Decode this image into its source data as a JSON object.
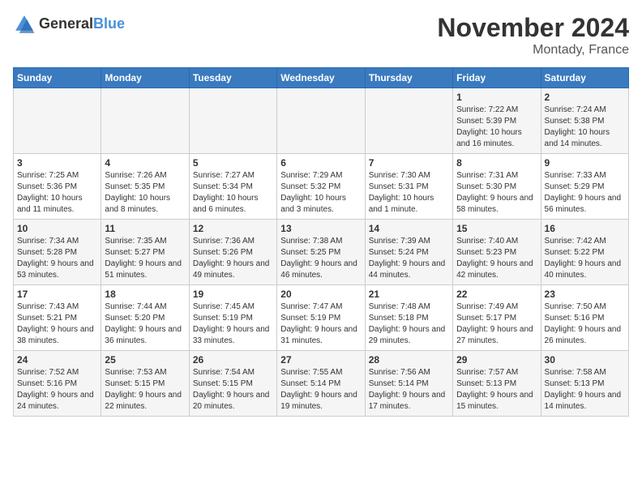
{
  "header": {
    "logo_line1": "General",
    "logo_line2": "Blue",
    "month_title": "November 2024",
    "location": "Montady, France"
  },
  "weekdays": [
    "Sunday",
    "Monday",
    "Tuesday",
    "Wednesday",
    "Thursday",
    "Friday",
    "Saturday"
  ],
  "weeks": [
    [
      {
        "day": "",
        "info": ""
      },
      {
        "day": "",
        "info": ""
      },
      {
        "day": "",
        "info": ""
      },
      {
        "day": "",
        "info": ""
      },
      {
        "day": "",
        "info": ""
      },
      {
        "day": "1",
        "info": "Sunrise: 7:22 AM\nSunset: 5:39 PM\nDaylight: 10 hours and 16 minutes."
      },
      {
        "day": "2",
        "info": "Sunrise: 7:24 AM\nSunset: 5:38 PM\nDaylight: 10 hours and 14 minutes."
      }
    ],
    [
      {
        "day": "3",
        "info": "Sunrise: 7:25 AM\nSunset: 5:36 PM\nDaylight: 10 hours and 11 minutes."
      },
      {
        "day": "4",
        "info": "Sunrise: 7:26 AM\nSunset: 5:35 PM\nDaylight: 10 hours and 8 minutes."
      },
      {
        "day": "5",
        "info": "Sunrise: 7:27 AM\nSunset: 5:34 PM\nDaylight: 10 hours and 6 minutes."
      },
      {
        "day": "6",
        "info": "Sunrise: 7:29 AM\nSunset: 5:32 PM\nDaylight: 10 hours and 3 minutes."
      },
      {
        "day": "7",
        "info": "Sunrise: 7:30 AM\nSunset: 5:31 PM\nDaylight: 10 hours and 1 minute."
      },
      {
        "day": "8",
        "info": "Sunrise: 7:31 AM\nSunset: 5:30 PM\nDaylight: 9 hours and 58 minutes."
      },
      {
        "day": "9",
        "info": "Sunrise: 7:33 AM\nSunset: 5:29 PM\nDaylight: 9 hours and 56 minutes."
      }
    ],
    [
      {
        "day": "10",
        "info": "Sunrise: 7:34 AM\nSunset: 5:28 PM\nDaylight: 9 hours and 53 minutes."
      },
      {
        "day": "11",
        "info": "Sunrise: 7:35 AM\nSunset: 5:27 PM\nDaylight: 9 hours and 51 minutes."
      },
      {
        "day": "12",
        "info": "Sunrise: 7:36 AM\nSunset: 5:26 PM\nDaylight: 9 hours and 49 minutes."
      },
      {
        "day": "13",
        "info": "Sunrise: 7:38 AM\nSunset: 5:25 PM\nDaylight: 9 hours and 46 minutes."
      },
      {
        "day": "14",
        "info": "Sunrise: 7:39 AM\nSunset: 5:24 PM\nDaylight: 9 hours and 44 minutes."
      },
      {
        "day": "15",
        "info": "Sunrise: 7:40 AM\nSunset: 5:23 PM\nDaylight: 9 hours and 42 minutes."
      },
      {
        "day": "16",
        "info": "Sunrise: 7:42 AM\nSunset: 5:22 PM\nDaylight: 9 hours and 40 minutes."
      }
    ],
    [
      {
        "day": "17",
        "info": "Sunrise: 7:43 AM\nSunset: 5:21 PM\nDaylight: 9 hours and 38 minutes."
      },
      {
        "day": "18",
        "info": "Sunrise: 7:44 AM\nSunset: 5:20 PM\nDaylight: 9 hours and 36 minutes."
      },
      {
        "day": "19",
        "info": "Sunrise: 7:45 AM\nSunset: 5:19 PM\nDaylight: 9 hours and 33 minutes."
      },
      {
        "day": "20",
        "info": "Sunrise: 7:47 AM\nSunset: 5:19 PM\nDaylight: 9 hours and 31 minutes."
      },
      {
        "day": "21",
        "info": "Sunrise: 7:48 AM\nSunset: 5:18 PM\nDaylight: 9 hours and 29 minutes."
      },
      {
        "day": "22",
        "info": "Sunrise: 7:49 AM\nSunset: 5:17 PM\nDaylight: 9 hours and 27 minutes."
      },
      {
        "day": "23",
        "info": "Sunrise: 7:50 AM\nSunset: 5:16 PM\nDaylight: 9 hours and 26 minutes."
      }
    ],
    [
      {
        "day": "24",
        "info": "Sunrise: 7:52 AM\nSunset: 5:16 PM\nDaylight: 9 hours and 24 minutes."
      },
      {
        "day": "25",
        "info": "Sunrise: 7:53 AM\nSunset: 5:15 PM\nDaylight: 9 hours and 22 minutes."
      },
      {
        "day": "26",
        "info": "Sunrise: 7:54 AM\nSunset: 5:15 PM\nDaylight: 9 hours and 20 minutes."
      },
      {
        "day": "27",
        "info": "Sunrise: 7:55 AM\nSunset: 5:14 PM\nDaylight: 9 hours and 19 minutes."
      },
      {
        "day": "28",
        "info": "Sunrise: 7:56 AM\nSunset: 5:14 PM\nDaylight: 9 hours and 17 minutes."
      },
      {
        "day": "29",
        "info": "Sunrise: 7:57 AM\nSunset: 5:13 PM\nDaylight: 9 hours and 15 minutes."
      },
      {
        "day": "30",
        "info": "Sunrise: 7:58 AM\nSunset: 5:13 PM\nDaylight: 9 hours and 14 minutes."
      }
    ]
  ]
}
